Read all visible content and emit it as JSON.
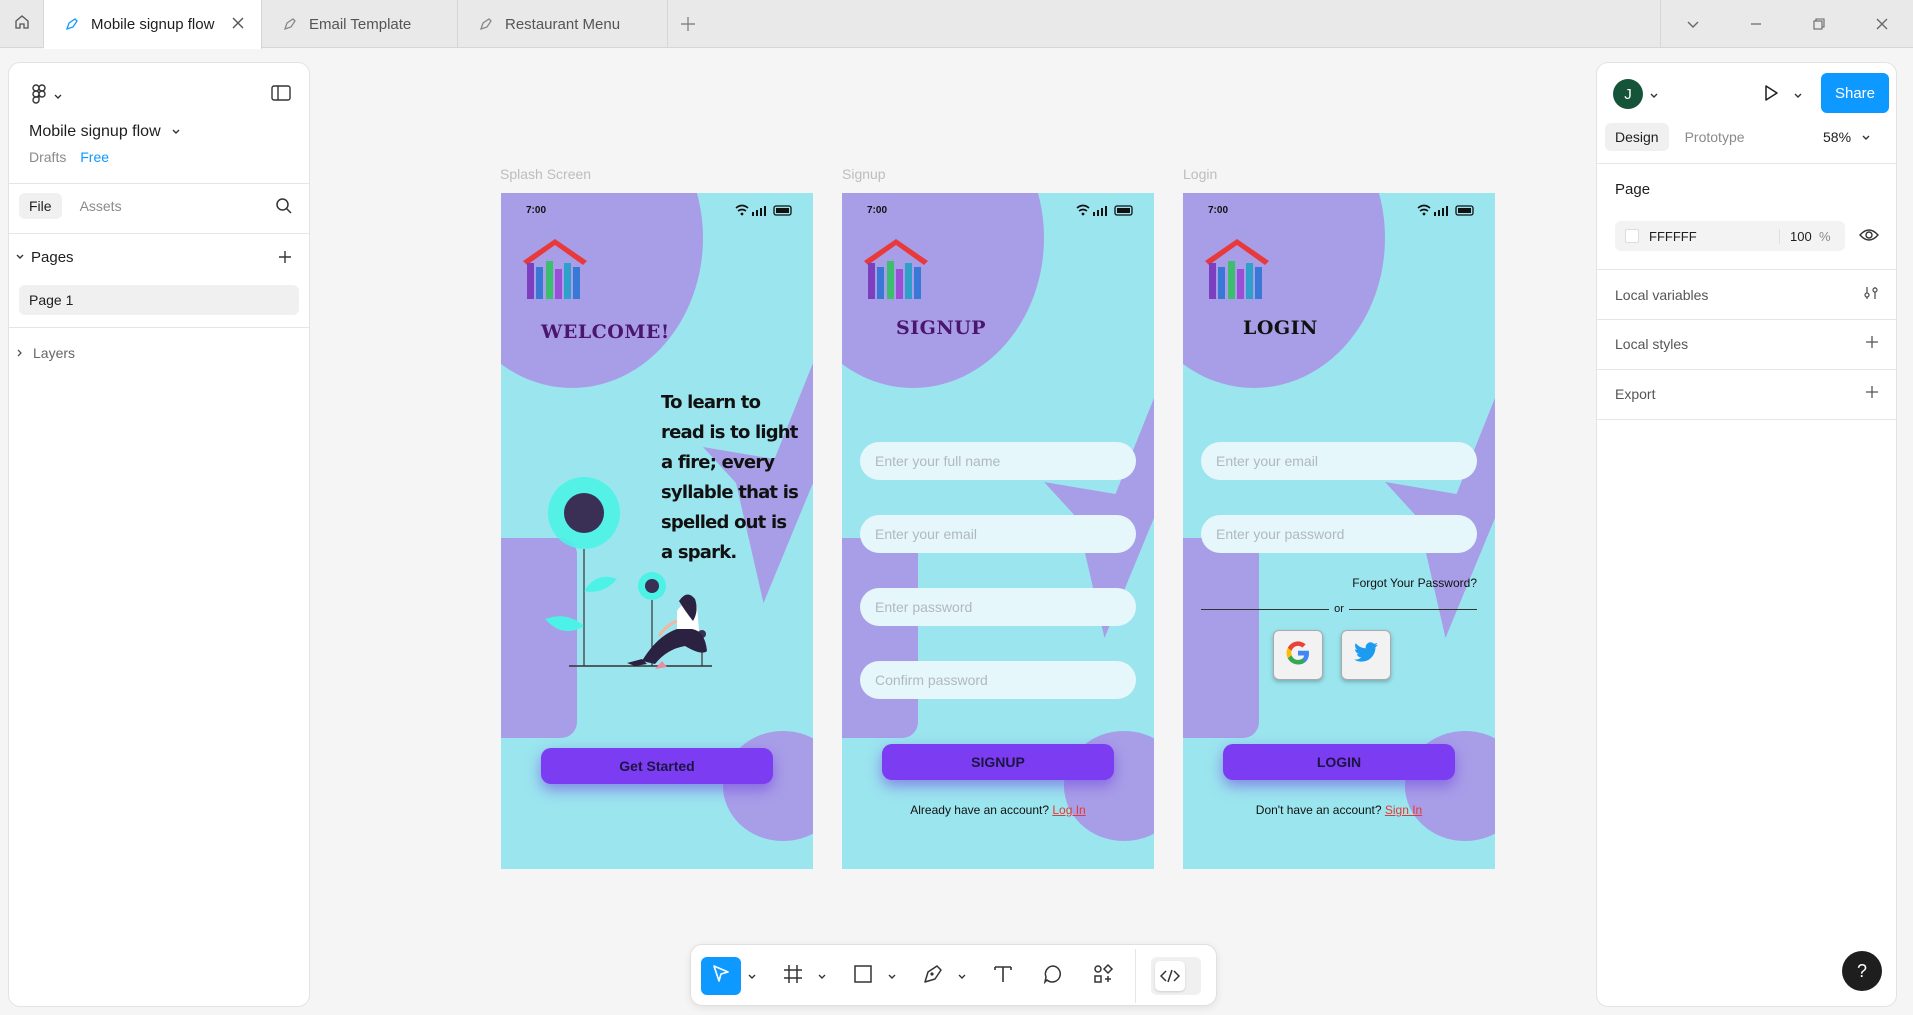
{
  "tabs": [
    {
      "label": "Mobile signup flow",
      "active": true
    },
    {
      "label": "Email Template",
      "active": false
    },
    {
      "label": "Restaurant Menu",
      "active": false
    }
  ],
  "left_panel": {
    "file_name": "Mobile signup flow",
    "location": "Drafts",
    "plan": "Free",
    "tab_file": "File",
    "tab_assets": "Assets",
    "pages_header": "Pages",
    "pages": [
      "Page 1"
    ],
    "layers_header": "Layers"
  },
  "right_panel": {
    "avatar_initial": "J",
    "share_label": "Share",
    "tab_design": "Design",
    "tab_prototype": "Prototype",
    "zoom": "58%",
    "page_section": "Page",
    "page_fill_hex": "FFFFFF",
    "page_fill_opacity": "100",
    "opacity_unit": "%",
    "local_variables": "Local variables",
    "local_styles": "Local styles",
    "export": "Export"
  },
  "help_label": "?",
  "frames": {
    "splash": {
      "label": "Splash Screen",
      "time": "7:00",
      "heading": "WELCOME!",
      "quote": "To learn to read is to light a fire; every syllable that is spelled out is a spark.",
      "cta": "Get Started"
    },
    "signup": {
      "label": "Signup",
      "time": "7:00",
      "heading": "SIGNUP",
      "fields": [
        "Enter your full name",
        "Enter your email",
        "Enter password",
        "Confirm password"
      ],
      "cta": "SIGNUP",
      "footer_text": "Already have an account?",
      "footer_link": "Log In"
    },
    "login": {
      "label": "Login",
      "time": "7:00",
      "heading": "LOGIN",
      "fields": [
        "Enter your email",
        "Enter your password"
      ],
      "forgot": "Forgot Your Password?",
      "or_text": "or",
      "cta": "LOGIN",
      "footer_text": "Don't have an account?",
      "footer_link": "Sign In"
    }
  },
  "colors": {
    "accent": "#0d99ff",
    "frame_bg": "#9be5ef",
    "blob": "#a89ee8",
    "button": "#7c3cf2",
    "heading_purple": "#4a1670",
    "link_red": "#e53935"
  },
  "toolbar_icons": [
    "move-icon",
    "frame-icon",
    "rectangle-icon",
    "pen-icon",
    "text-icon",
    "comment-icon",
    "actions-icon",
    "dev-mode-icon"
  ]
}
